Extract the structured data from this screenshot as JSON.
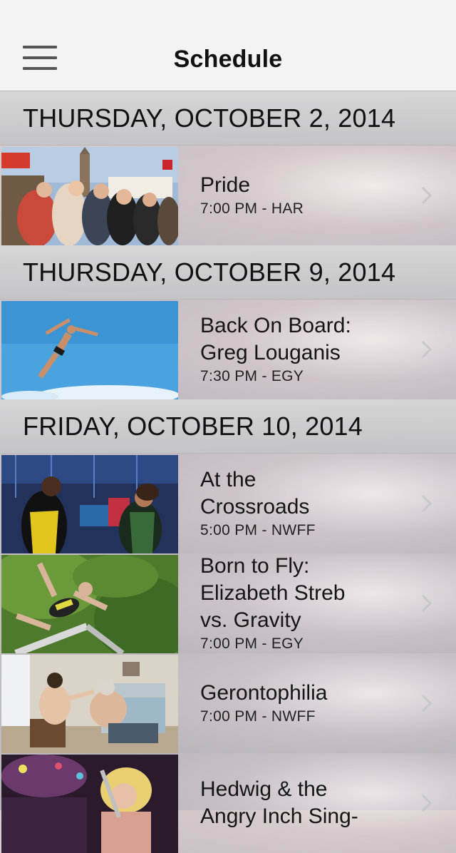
{
  "nav": {
    "title": "Schedule"
  },
  "icons": {
    "menu": "hamburger-menu-icon",
    "disclosure": "chevron-right-icon"
  },
  "colors": {
    "nav_bg": "#f3f3f3",
    "section_bg": "#d4d4d4",
    "chevron": "#c7c7cc",
    "text": "#151515"
  },
  "sections": [
    {
      "header": "THURSDAY, OCTOBER 2, 2014",
      "films": [
        {
          "title_lines": [
            "Pride"
          ],
          "time": "7:00 PM - HAR"
        }
      ]
    },
    {
      "header": "THURSDAY, OCTOBER 9, 2014",
      "films": [
        {
          "title_lines": [
            "Back On Board:",
            "Greg Louganis"
          ],
          "time": "7:30 PM - EGY"
        }
      ]
    },
    {
      "header": "FRIDAY, OCTOBER 10, 2014",
      "films": [
        {
          "title_lines": [
            "At the",
            "Crossroads"
          ],
          "time": "5:00 PM - NWFF"
        },
        {
          "title_lines": [
            "Born to Fly:",
            "Elizabeth Streb",
            "vs. Gravity"
          ],
          "time": "7:00 PM - EGY"
        },
        {
          "title_lines": [
            "Gerontophilia"
          ],
          "time": "7:00 PM - NWFF"
        },
        {
          "title_lines": [
            "Hedwig & the",
            "Angry Inch Sing-"
          ],
          "time": ""
        }
      ]
    }
  ]
}
